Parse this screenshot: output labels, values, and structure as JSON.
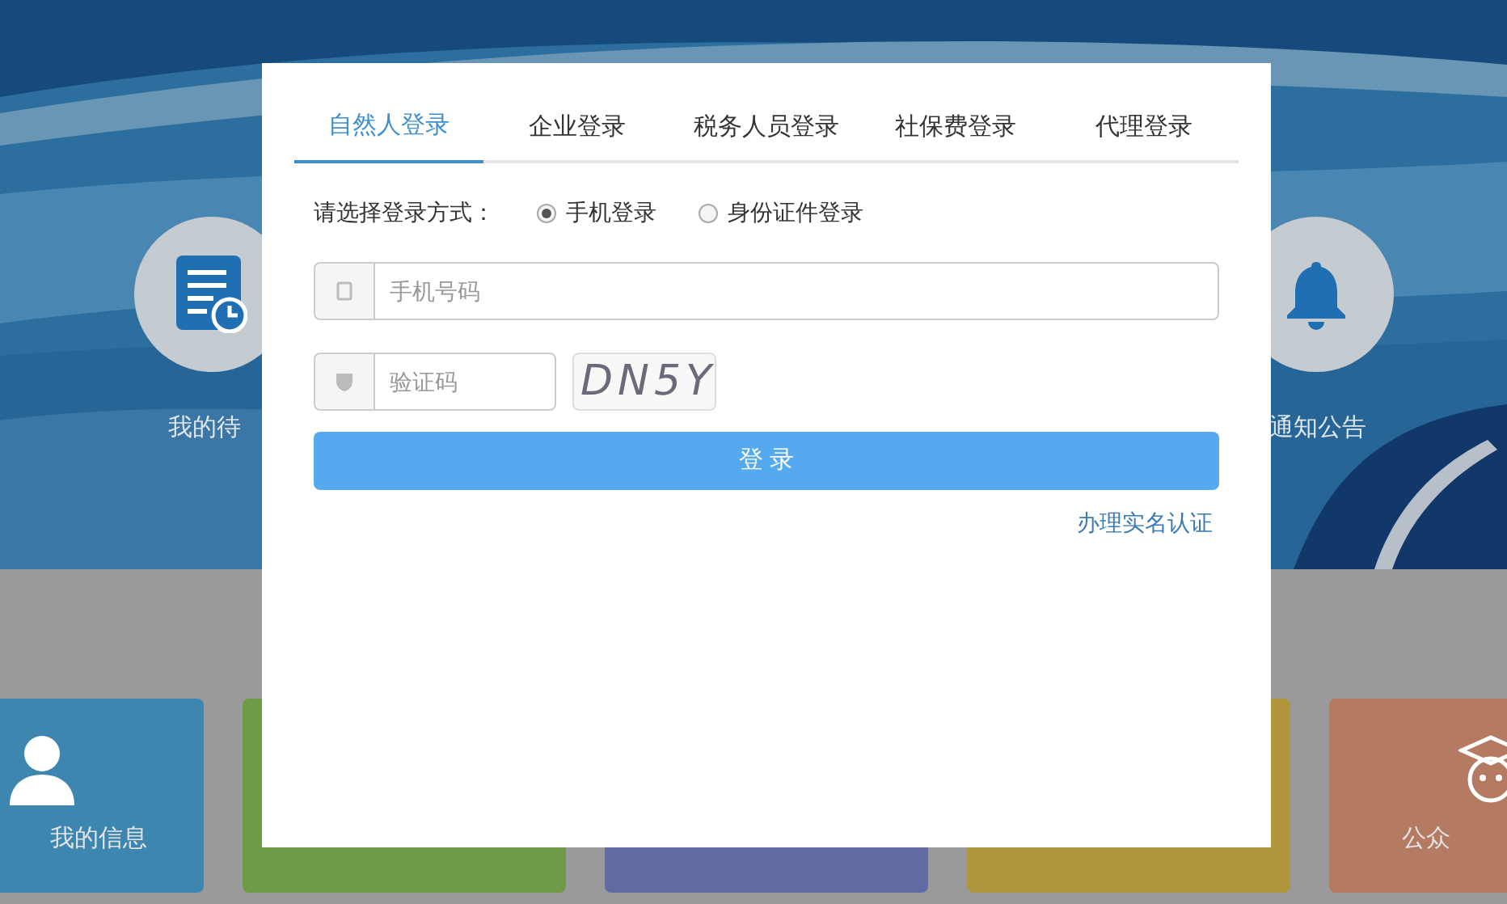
{
  "background": {
    "shortcuts": [
      {
        "label": "我的待",
        "kind": "document"
      },
      {
        "label": "通知公告",
        "kind": "bell"
      }
    ],
    "tiles": [
      {
        "label": "我的信息",
        "kind": "person",
        "color": "#3d86b0"
      },
      {
        "kind": "plain",
        "color": "#6f9a47"
      },
      {
        "kind": "plain",
        "color": "#606ba3"
      },
      {
        "kind": "plain",
        "color": "#b0973e"
      },
      {
        "label": "公众",
        "kind": "mascot",
        "color": "#b57a62"
      }
    ]
  },
  "dialog": {
    "tabs": [
      {
        "label": "自然人登录",
        "selected": true
      },
      {
        "label": "企业登录",
        "selected": false
      },
      {
        "label": "税务人员登录",
        "selected": false
      },
      {
        "label": "社保费登录",
        "selected": false
      },
      {
        "label": "代理登录",
        "selected": false
      }
    ],
    "method_prompt": "请选择登录方式：",
    "methods": [
      {
        "label": "手机登录",
        "selected": true
      },
      {
        "label": "身份证件登录",
        "selected": false
      }
    ],
    "phone_field": {
      "placeholder": "手机号码"
    },
    "code_field": {
      "placeholder": "验证码"
    },
    "captcha": "DN5Y",
    "login_button": "登 录",
    "verify_link": "办理实名认证"
  }
}
